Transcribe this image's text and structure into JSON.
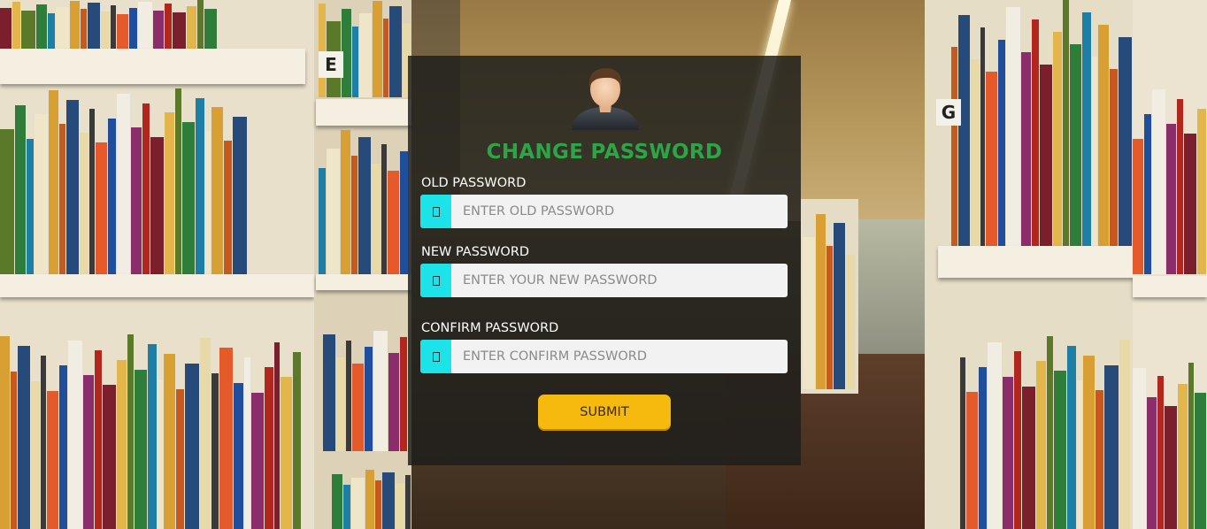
{
  "form": {
    "title": "CHANGE PASSWORD",
    "fields": [
      {
        "label": "OLD PASSWORD",
        "placeholder": "ENTER OLD PASSWORD",
        "value": "",
        "icon": "lock-icon"
      },
      {
        "label": "NEW PASSWORD",
        "placeholder": "ENTER YOUR NEW PASSWORD",
        "value": "",
        "icon": "lock-icon"
      },
      {
        "label": "CONFIRM PASSWORD",
        "placeholder": "ENTER CONFIRM PASSWORD",
        "value": "",
        "icon": "lock-icon"
      }
    ],
    "submit_label": "SUBMIT"
  },
  "avatar": {
    "icon": "user-avatar-icon"
  },
  "background": {
    "scene": "library-bookshelves",
    "shelf_signs": [
      "E",
      "G"
    ]
  },
  "colors": {
    "title": "#2da546",
    "addon": "#1ce3e8",
    "submit": "#f6b90d",
    "card": "rgba(30,30,28,0.84)"
  }
}
